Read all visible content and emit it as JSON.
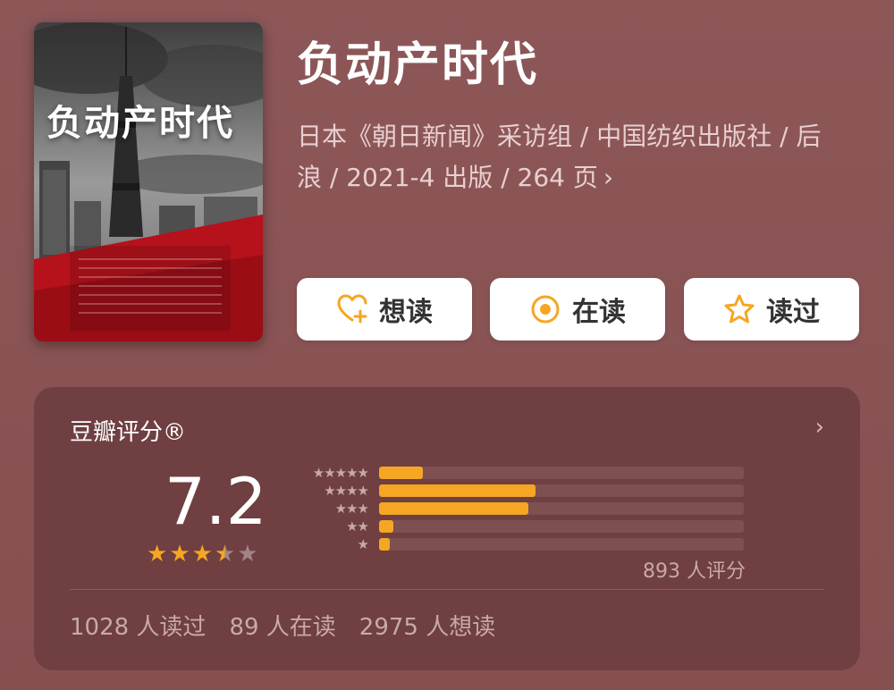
{
  "book": {
    "title": "负动产时代",
    "meta": "日本《朝日新闻》采访组 / 中国纺织出版社 / 后浪 / 2021-4 出版 / 264 页",
    "chevron": "›",
    "cover": {
      "title": "负动产时代"
    }
  },
  "actions": {
    "want": "想读",
    "reading": "在读",
    "read": "读过"
  },
  "rating": {
    "label": "豆瓣评分®",
    "score": "7.2",
    "stars_value": 3.5,
    "count_text": "893 人评分",
    "distribution": [
      {
        "stars": "★★★★★",
        "fraction": 0.12
      },
      {
        "stars": "★★★★",
        "fraction": 0.43
      },
      {
        "stars": "★★★",
        "fraction": 0.41
      },
      {
        "stars": "★★",
        "fraction": 0.04
      },
      {
        "stars": "★",
        "fraction": 0.03
      }
    ],
    "stats": {
      "read": "1028 人读过",
      "reading": "89 人在读",
      "want": "2975 人想读"
    }
  },
  "colors": {
    "accent": "#f5a623",
    "background": "#8a5455",
    "card": "#6f3f41"
  }
}
